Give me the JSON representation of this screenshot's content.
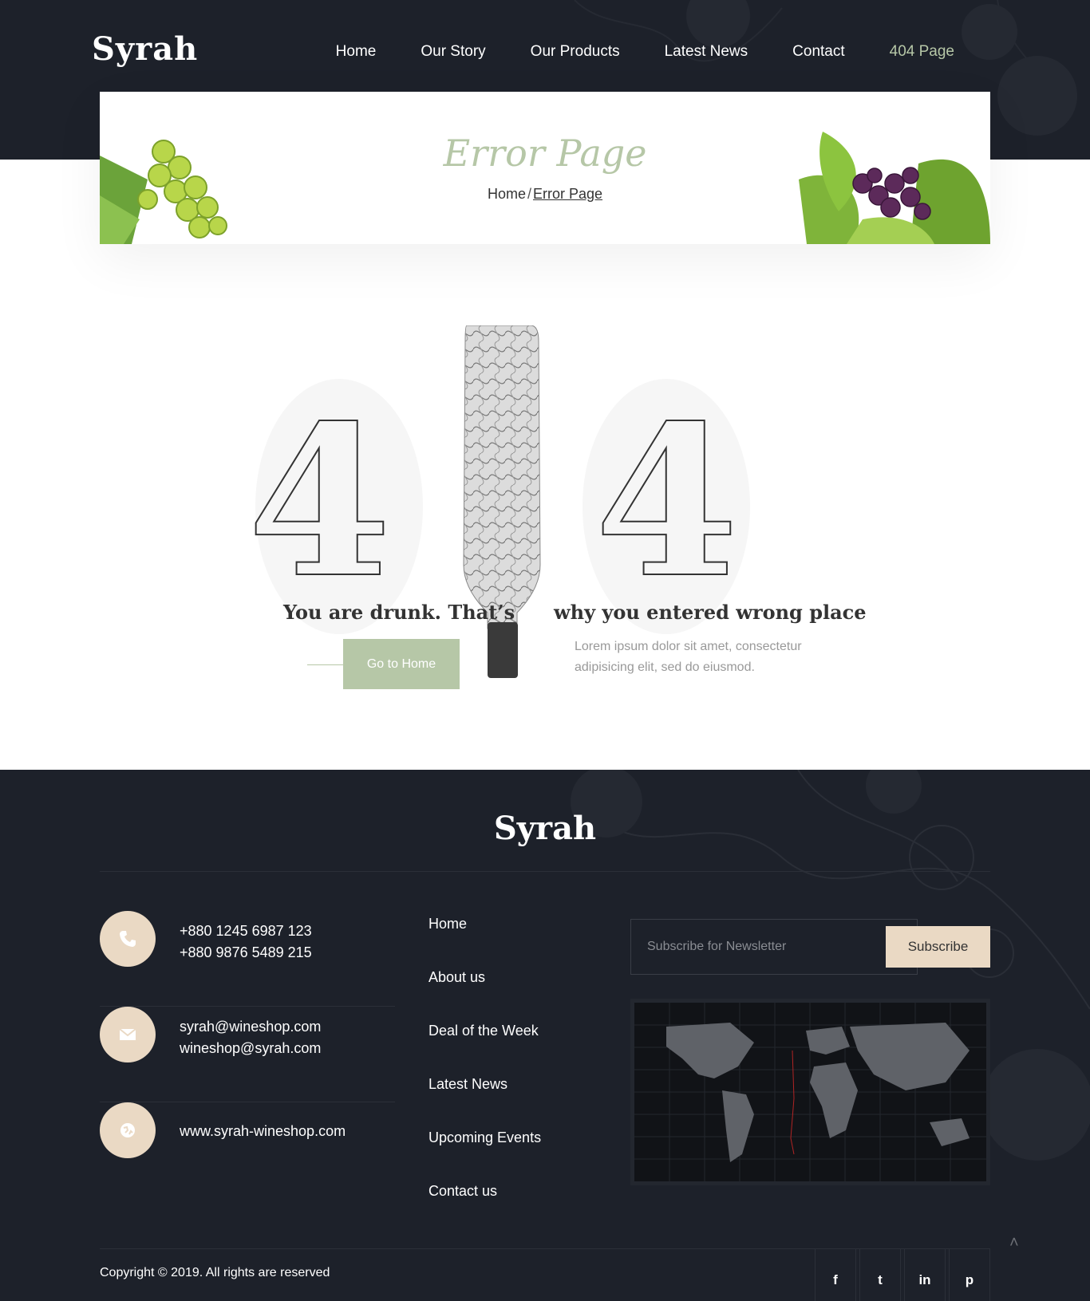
{
  "header": {
    "logo": "Syrah",
    "nav": [
      "Home",
      "Our Story",
      "Our Products",
      "Latest News",
      "Contact",
      "404 Page"
    ],
    "active_nav": "404 Page"
  },
  "hero": {
    "title": "Error Page",
    "breadcrumb_home": "Home",
    "breadcrumb_sep": "/",
    "breadcrumb_current": "Error Page"
  },
  "error": {
    "digit_left": "4",
    "digit_right": "4",
    "line1": "You are drunk. That’s",
    "line2": "why you entered wrong place",
    "button": "Go to Home",
    "text": "Lorem ipsum dolor sit amet, consectetur adipisicing elit, sed do eiusmod."
  },
  "footer": {
    "logo": "Syrah",
    "phones": [
      "+880 1245 6987 123",
      "+880 9876 5489 215"
    ],
    "emails": [
      "syrah@wineshop.com",
      "wineshop@syrah.com"
    ],
    "website": "www.syrah-wineshop.com",
    "links": [
      "Home",
      "About us",
      "Deal of the Week",
      "Latest News",
      "Upcoming Events",
      "Contact us"
    ],
    "newsletter_placeholder": "Subscribe for Newsletter",
    "subscribe": "Subscribe",
    "copyright": "Copyright © 2019. All rights are reserved",
    "social": [
      "f",
      "t",
      "in",
      "p"
    ],
    "accent": "#b6c7a7",
    "beige": "#ead9c4",
    "dark": "#1d212a"
  }
}
